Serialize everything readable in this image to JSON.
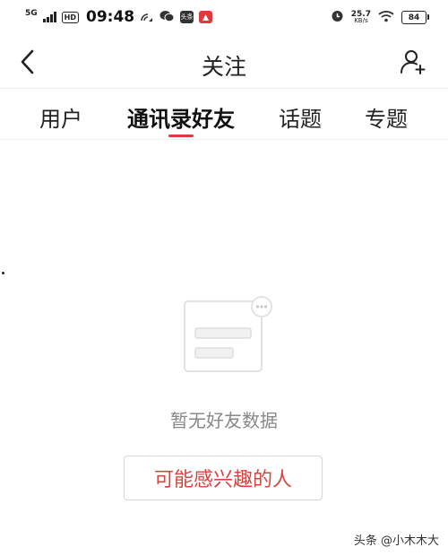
{
  "status_bar": {
    "network": "5G",
    "hd": "HD",
    "time": "09:48",
    "app_badge": "头条",
    "speed_value": "25.7",
    "speed_unit": "KB/s",
    "battery": "84",
    "icons": [
      "signal-icon",
      "hotspot-icon",
      "wechat-icon",
      "toutiao-icon",
      "red-app-icon",
      "alarm-icon",
      "wifi-icon",
      "battery-icon"
    ]
  },
  "header": {
    "title": "关注",
    "back_icon": "chevron-left-icon",
    "add_icon": "add-user-icon"
  },
  "tabs": [
    {
      "label": "用户",
      "active": false
    },
    {
      "label": "通讯录好友",
      "active": true
    },
    {
      "label": "话题",
      "active": false
    },
    {
      "label": "专题",
      "active": false
    }
  ],
  "empty_state": {
    "message": "暂无好友数据",
    "button_label": "可能感兴趣的人",
    "illustration_icon": "empty-contacts-icon"
  },
  "watermark": "头条 @小木木大",
  "colors": {
    "accent": "#e0393b",
    "button_text": "#d9443f",
    "muted_text": "#888888",
    "border": "#d6d6d6"
  }
}
